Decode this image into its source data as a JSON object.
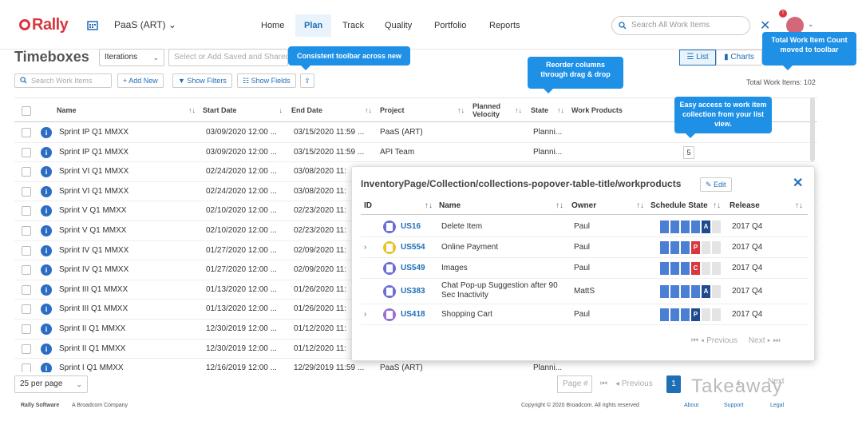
{
  "app": {
    "logo": "Rally",
    "workspace": "PaaS (ART)",
    "nav": [
      "Home",
      "Plan",
      "Track",
      "Quality",
      "Portfolio",
      "Reports"
    ],
    "active_nav": "Plan",
    "search_placeholder": "Search All Work Items",
    "notification_count": "!"
  },
  "callouts": {
    "toolbar": "Consistent toolbar across new",
    "reorder": "Reorder columns through drag & drop",
    "count": "Total Work Item Count moved to toolbar",
    "access": "Easy access to work item collection from your list view."
  },
  "page": {
    "title": "Timeboxes",
    "type_select": "Iterations",
    "view_placeholder": "Select or Add Saved and Shared Views",
    "list_label": "List",
    "charts_label": "Charts",
    "total": "Total Work Items: 102",
    "search_placeholder": "Search Work Items",
    "add_new": "+ Add New",
    "show_filters": "Show Filters",
    "show_fields": "Show Fields"
  },
  "grid": {
    "columns": [
      "Name",
      "Start Date",
      "End Date",
      "Project",
      "Planned Velocity",
      "State",
      "Work Products"
    ],
    "rows": [
      {
        "name": "Sprint IP Q1 MMXX",
        "start": "03/09/2020 12:00 ...",
        "end": "03/15/2020 11:59 ...",
        "project": "PaaS (ART)",
        "state": "Planni...",
        "wp": ""
      },
      {
        "name": "Sprint IP Q1 MMXX",
        "start": "03/09/2020 12:00 ...",
        "end": "03/15/2020 11:59 ...",
        "project": "API Team",
        "state": "Planni...",
        "wp": "5"
      },
      {
        "name": "Sprint VI Q1 MMXX",
        "start": "02/24/2020 12:00 ...",
        "end": "03/08/2020 11:",
        "project": "",
        "state": "",
        "wp": ""
      },
      {
        "name": "Sprint VI Q1 MMXX",
        "start": "02/24/2020 12:00 ...",
        "end": "03/08/2020 11:",
        "project": "",
        "state": "",
        "wp": ""
      },
      {
        "name": "Sprint V Q1 MMXX",
        "start": "02/10/2020 12:00 ...",
        "end": "02/23/2020 11:",
        "project": "",
        "state": "",
        "wp": ""
      },
      {
        "name": "Sprint V Q1 MMXX",
        "start": "02/10/2020 12:00 ...",
        "end": "02/23/2020 11:",
        "project": "",
        "state": "",
        "wp": ""
      },
      {
        "name": "Sprint IV Q1 MMXX",
        "start": "01/27/2020 12:00 ...",
        "end": "02/09/2020 11:",
        "project": "",
        "state": "",
        "wp": ""
      },
      {
        "name": "Sprint IV Q1 MMXX",
        "start": "01/27/2020 12:00 ...",
        "end": "02/09/2020 11:",
        "project": "",
        "state": "",
        "wp": ""
      },
      {
        "name": "Sprint III Q1 MMXX",
        "start": "01/13/2020 12:00 ...",
        "end": "01/26/2020 11:",
        "project": "",
        "state": "",
        "wp": ""
      },
      {
        "name": "Sprint III Q1 MMXX",
        "start": "01/13/2020 12:00 ...",
        "end": "01/26/2020 11:",
        "project": "",
        "state": "",
        "wp": ""
      },
      {
        "name": "Sprint II Q1 MMXX",
        "start": "12/30/2019 12:00 ...",
        "end": "01/12/2020 11:",
        "project": "",
        "state": "",
        "wp": ""
      },
      {
        "name": "Sprint II Q1 MMXX",
        "start": "12/30/2019 12:00 ...",
        "end": "01/12/2020 11:",
        "project": "",
        "state": "",
        "wp": ""
      },
      {
        "name": "Sprint I Q1 MMXX",
        "start": "12/16/2019 12:00 ...",
        "end": "12/29/2019 11:59 ...",
        "project": "PaaS (ART)",
        "state": "Planni...",
        "wp": ""
      }
    ]
  },
  "footer": {
    "per_page": "25 per page",
    "page_placeholder": "Page #",
    "previous": "Previous",
    "page_num": "1",
    "next": "Next",
    "page_4": "4",
    "company": "Rally Software",
    "broadcom": "A Broadcom Company",
    "copyright": "Copyright © 2020 Broadcom. All rights reserved",
    "about": "About",
    "support": "Support",
    "legal": "Legal",
    "watermark": "Takeaway"
  },
  "popover": {
    "title": "InventoryPage/Collection/collections-popover-table-title/workproducts",
    "edit": "Edit",
    "columns": [
      "ID",
      "Name",
      "Owner",
      "Schedule State",
      "Release"
    ],
    "rows": [
      {
        "id": "US16",
        "name": "Delete Item",
        "owner": "Paul",
        "state": "A",
        "state_index": 4,
        "release": "2017 Q4",
        "color": "#6a6fd4",
        "expandable": false
      },
      {
        "id": "US554",
        "name": "Online Payment",
        "owner": "Paul",
        "state": "P",
        "state_index": 3,
        "release": "2017 Q4",
        "color": "#e8c32a",
        "expandable": true
      },
      {
        "id": "US549",
        "name": "Images",
        "owner": "Paul",
        "state": "C",
        "state_index": 3,
        "release": "2017 Q4",
        "color": "#6a6fd4",
        "expandable": false
      },
      {
        "id": "US383",
        "name": "Chat Pop-up Suggestion after 90 Sec Inactivity",
        "owner": "MattS",
        "state": "A",
        "state_index": 4,
        "release": "2017 Q4",
        "color": "#6a6fd4",
        "expandable": false
      },
      {
        "id": "US418",
        "name": "Shopping Cart",
        "owner": "Paul",
        "state": "P",
        "state_index": 3,
        "release": "2017 Q4",
        "color": "#9b6fd4",
        "expandable": true
      }
    ],
    "previous": "Previous",
    "next": "Next"
  }
}
